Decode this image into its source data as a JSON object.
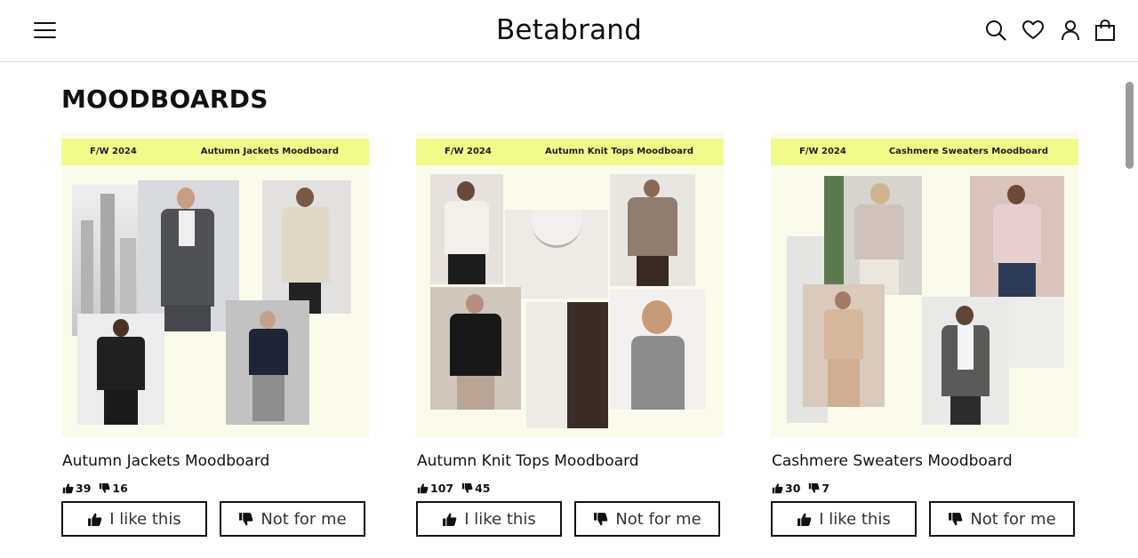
{
  "header": {
    "logo": "Betabrand",
    "icons": [
      "menu-icon",
      "search-icon",
      "heart-icon",
      "user-icon",
      "bag-icon"
    ]
  },
  "page": {
    "title": "MOODBOARDS"
  },
  "colors": {
    "band": "#f1fb8a",
    "board": "#fbfbec",
    "border": "#111111"
  },
  "cards": [
    {
      "season": "F/W 2024",
      "board_title": "Autumn Jackets Moodboard",
      "title": "Autumn Jackets Moodboard",
      "likes": "39",
      "dislikes": "16",
      "like_label": "I like this",
      "dislike_label": "Not for me"
    },
    {
      "season": "F/W 2024",
      "board_title": "Autumn Knit Tops Moodboard",
      "title": "Autumn Knit Tops Moodboard",
      "likes": "107",
      "dislikes": "45",
      "like_label": "I like this",
      "dislike_label": "Not for me"
    },
    {
      "season": "F/W 2024",
      "board_title": "Cashmere Sweaters Moodboard",
      "title": "Cashmere Sweaters Moodboard",
      "likes": "30",
      "dislikes": "7",
      "like_label": "I like this",
      "dislike_label": "Not for me"
    }
  ]
}
